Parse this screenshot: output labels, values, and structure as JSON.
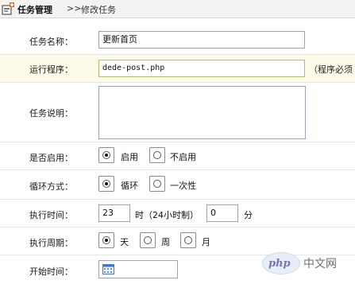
{
  "breadcrumb": {
    "icon": "task-add-icon",
    "title": "任务管理",
    "separator": ">>",
    "current": "修改任务"
  },
  "form": {
    "task_name": {
      "label": "任务名称：",
      "value": "更新首页"
    },
    "program": {
      "label": "运行程序：",
      "value": "dede-post.php",
      "hint": "（程序必须"
    },
    "description": {
      "label": "任务说明：",
      "value": ""
    },
    "enabled": {
      "label": "是否启用：",
      "options": [
        {
          "label": "启用",
          "checked": true
        },
        {
          "label": "不启用",
          "checked": false
        }
      ]
    },
    "loop_mode": {
      "label": "循环方式：",
      "options": [
        {
          "label": "循环",
          "checked": true
        },
        {
          "label": "一次性",
          "checked": false
        }
      ]
    },
    "exec_time": {
      "label": "执行时间：",
      "hour": "23",
      "hour_unit": "时（24小时制）",
      "minute": "0",
      "minute_unit": "分"
    },
    "exec_cycle": {
      "label": "执行周期：",
      "options": [
        {
          "label": "天",
          "checked": true
        },
        {
          "label": "周",
          "checked": false
        },
        {
          "label": "月",
          "checked": false
        }
      ]
    },
    "start_time": {
      "label": "开始时间：",
      "value": "",
      "icon": "calendar-icon"
    }
  },
  "watermark": {
    "brand": "php",
    "site": "中文网"
  },
  "colors": {
    "header_bg": "#f3f3f3",
    "highlight_row": "#fffbea",
    "input_border": "#9aa4b2"
  }
}
